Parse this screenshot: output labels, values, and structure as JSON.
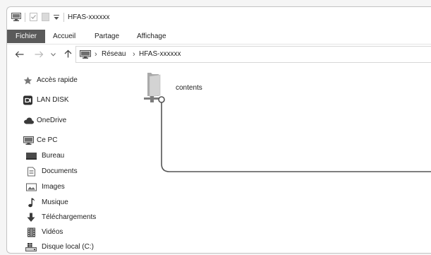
{
  "window": {
    "title": "HFAS-xxxxxx",
    "quick_access_toolbar": [
      "computer-icon",
      "properties-check-icon",
      "new-folder-icon",
      "customize-toolbar-dropdown-icon"
    ]
  },
  "ribbon": {
    "tabs": [
      {
        "label": "Fichier",
        "active": true
      },
      {
        "label": "Accueil",
        "active": false
      },
      {
        "label": "Partage",
        "active": false
      },
      {
        "label": "Affichage",
        "active": false
      }
    ]
  },
  "address_bar": {
    "buttons": [
      {
        "icon": "back-arrow-icon",
        "enabled": true
      },
      {
        "icon": "forward-arrow-icon",
        "enabled": false
      },
      {
        "icon": "recent-locations-chevron-icon",
        "enabled": true
      },
      {
        "icon": "up-arrow-icon",
        "enabled": true
      }
    ],
    "location_icon": "computer-icon",
    "separator": "›",
    "path": [
      "Réseau",
      "HFAS-xxxxxx"
    ]
  },
  "navigation_pane": {
    "items": [
      {
        "label": "Accès rapide",
        "icon": "quick-access-star-icon"
      },
      {
        "label": "LAN DISK",
        "icon": "lan-disk-icon"
      },
      {
        "label": "OneDrive",
        "icon": "onedrive-cloud-icon"
      },
      {
        "label": "Ce PC",
        "icon": "this-pc-computer-icon",
        "children": [
          {
            "label": "Bureau",
            "icon": "desktop-icon"
          },
          {
            "label": "Documents",
            "icon": "documents-icon"
          },
          {
            "label": "Images",
            "icon": "images-icon"
          },
          {
            "label": "Musique",
            "icon": "music-icon"
          },
          {
            "label": "Téléchargements",
            "icon": "downloads-icon"
          },
          {
            "label": "Vidéos",
            "icon": "videos-icon"
          },
          {
            "label": "Disque local (C:)",
            "icon": "local-disk-icon"
          }
        ]
      }
    ]
  },
  "content": {
    "items": [
      {
        "label": "contents",
        "icon": "network-share-folder-icon"
      }
    ]
  },
  "colors": {
    "active_tab_bg": "#5a5a5a",
    "active_tab_text": "#ffffff",
    "text": "#222222",
    "disabled": "#b8b8b8",
    "callout_line": "#555555"
  }
}
